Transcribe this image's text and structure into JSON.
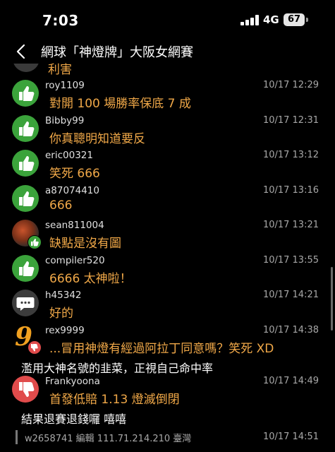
{
  "status": {
    "time": "7:03",
    "network": "4G",
    "battery": "67"
  },
  "nav": {
    "title": "網球「神燈牌」大阪女網賽"
  },
  "partial_text": "利害",
  "comments": [
    {
      "user": "roy1109",
      "time": "10/17 12:29",
      "text": "對開 100 場勝率保底 7 成",
      "avatar": "thumbs-up"
    },
    {
      "user": "Bibby99",
      "time": "10/17 12:31",
      "text": "你真聰明知道要反",
      "avatar": "thumbs-up"
    },
    {
      "user": "eric00321",
      "time": "10/17 13:12",
      "text": "笑死 666",
      "avatar": "thumbs-up"
    },
    {
      "user": "a87074410",
      "time": "10/17 13:16",
      "text": "666",
      "avatar": "thumbs-up"
    },
    {
      "user": "sean811004",
      "time": "10/17 13:21",
      "text": "缺點是沒有圖",
      "avatar": "photo-with-up-badge"
    },
    {
      "user": "compiler520",
      "time": "10/17 13:55",
      "text": "6666 太神啦！",
      "avatar": "thumbs-up"
    },
    {
      "user": "h45342",
      "time": "10/17 14:21",
      "text": "好的",
      "avatar": "speech-bubble"
    },
    {
      "user": "rex9999",
      "time": "10/17 14:38",
      "text": "...冒用神燈有經過阿拉丁同意嗎？笑死 XD",
      "extra": "濫用大神名號的韭菜，正視自己命中率",
      "avatar": "nine-with-down-badge"
    },
    {
      "user": "Frankyoona",
      "time": "10/17 14:49",
      "text": "首發低賠 1.13 燈滅倒閉",
      "extra": "結果退賽退錢囉 嘻嘻",
      "avatar": "thumbs-down"
    }
  ],
  "footer": {
    "text": "w2658741 編輯 111.71.214.210 臺灣",
    "time": "10/17 14:51"
  }
}
